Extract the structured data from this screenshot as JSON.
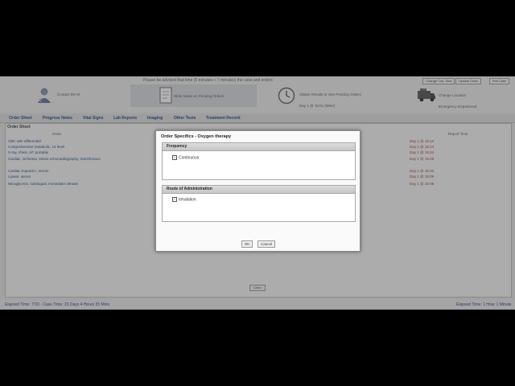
{
  "banner": {
    "notice": "Please be advised that time (5 minutes + 7 minutes) the case and orders",
    "buttons": [
      "Change Cos. Size",
      "Update Clock",
      "Exit Case"
    ],
    "panels": [
      {
        "icon": "doctor-icon",
        "text": "Contact the M"
      },
      {
        "icon": "document-icon",
        "text": "Write Notes on Pending Orders"
      },
      {
        "icon": "clock-icon",
        "text": "Obtain Results or See Pending Orders",
        "sub": "Day 1 @ 15:01 (Mine)"
      },
      {
        "icon": "ambulance-icon",
        "text": "Change Location",
        "sub": "Emergency Department"
      }
    ]
  },
  "tabs": [
    "Order Sheet",
    "Progress Notes",
    "Vital Signs",
    "Lab Reports",
    "Imaging",
    "Other Tests",
    "Treatment Record"
  ],
  "order_sheet": {
    "title": "Order Sheet",
    "columns": [
      "Order",
      "Report Time"
    ],
    "rows": [
      {
        "order": "CBC with differential",
        "time": "Day 1 @ 15:14"
      },
      {
        "order": "Comprehensive metabolic, 12 level",
        "time": "Day 1 @ 15:14"
      },
      {
        "order": "X-ray, chest, AP, portable",
        "time": "Day 1 @ 15:24"
      },
      {
        "order": "Cardiac, ischemia, stress echocardiography, transthoracic",
        "time": "Day 1 @ 15:28"
      },
      {
        "order": "Cardiac troponin I, serum",
        "time": "Day 1 @ 15:33"
      },
      {
        "order": "Lipase, serum",
        "time": "Day 1 @ 15:09"
      },
      {
        "order": "Nitroglycerin, sublingual, immediate release",
        "time": "Day 1 @ 15:09"
      }
    ],
    "button": "Clear"
  },
  "footer": {
    "left": "Elapsed Time: 7:03 · Case Time: 15 Days 4 Hours 35 Mins",
    "right": "Elapsed Time: 1 Hour 1 Minute"
  },
  "dialog": {
    "title": "Order Specifics - Oxygen therapy",
    "frequency_label": "Frequency",
    "frequency_option": "Continuous",
    "route_label": "Route of Administration",
    "route_option": "Inhalation",
    "ok_label": "OK",
    "cancel_label": "Cancel"
  },
  "colors": {
    "link": "#1b3f86",
    "time": "#a33333",
    "overlay": "#464646",
    "frame": "#000000"
  }
}
